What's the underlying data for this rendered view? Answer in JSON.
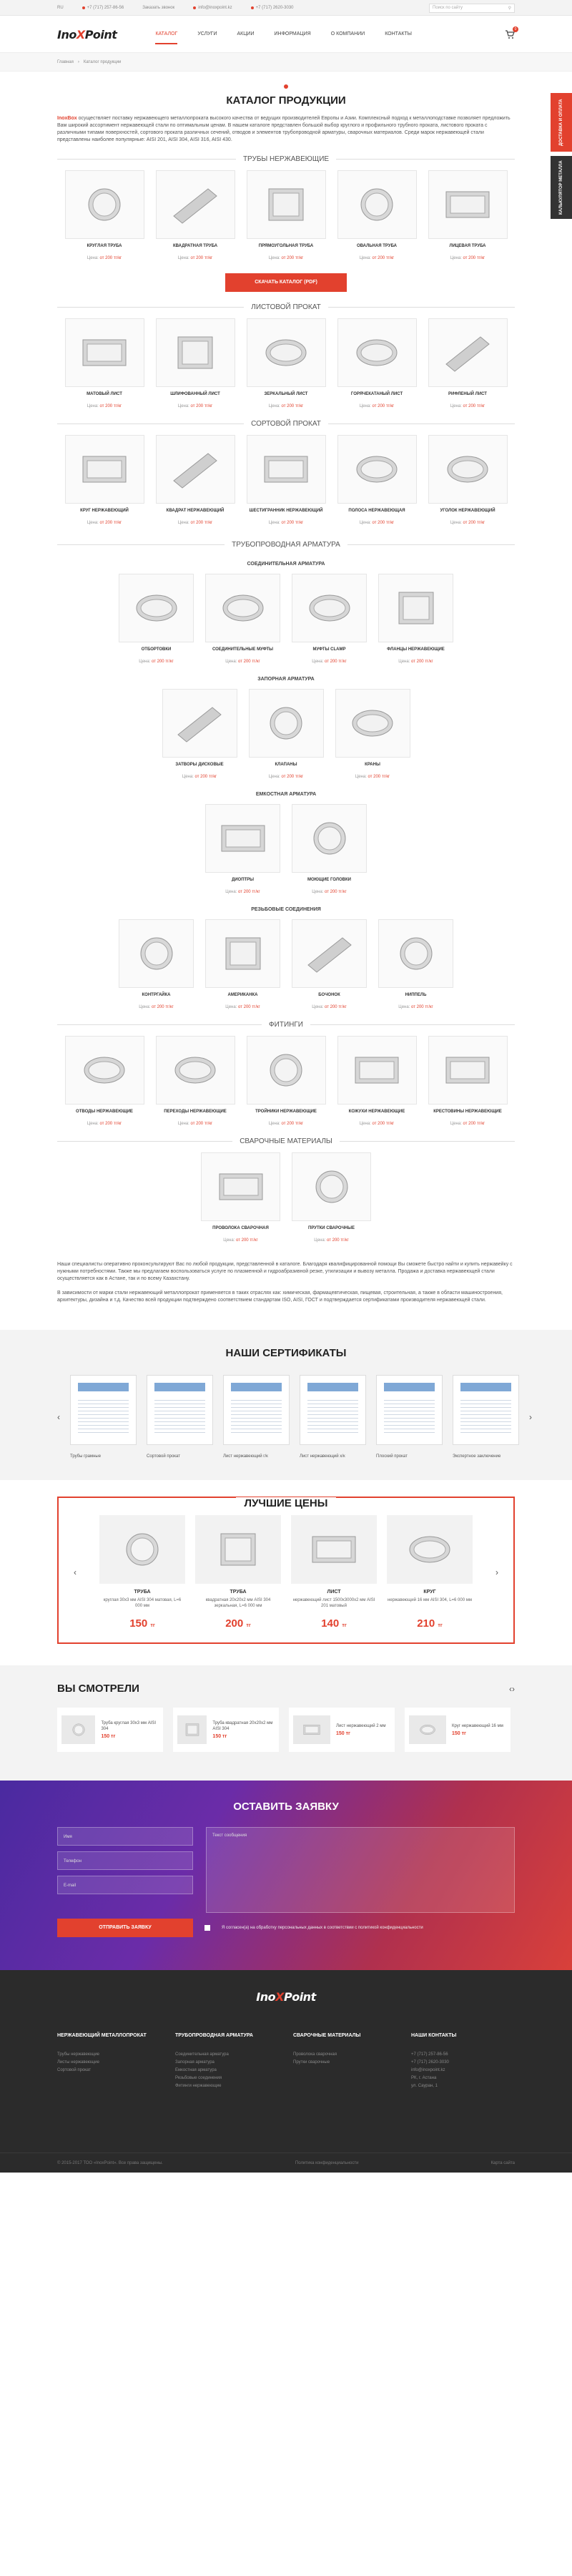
{
  "topbar": {
    "lang": "RU",
    "phone1": "+7 (717) 257-86-56",
    "callback": "Заказать звонок",
    "email": "info@inoxpoint.kz",
    "phone2": "+7 (717) 2620-3030",
    "search_placeholder": "Поиск по сайту"
  },
  "header": {
    "logo_a": "Ino",
    "logo_x": "X",
    "logo_b": "Point",
    "nav": [
      "Каталог",
      "Услуги",
      "Акции",
      "Информация",
      "О компании",
      "Контакты"
    ],
    "cart_count": "0"
  },
  "breadcrumbs": [
    "Главная",
    "Каталог продукции"
  ],
  "side_tabs": [
    "Доставка и оплата",
    "Калькулятор металла"
  ],
  "catalog": {
    "title": "КАТАЛОГ ПРОДУКЦИИ",
    "brand": "InoxBox",
    "intro": " осуществляет поставку нержавеющего металлопроката высокого качества от ведущих производителей Европы и Азии. Комплексный подход к металлоподставке позволяет предложить Вам широкий ассортимент нержавеющей стали по оптимальным ценам. В нашем каталоге представлен большой выбор круглого и профильного трубного проката, листового проката с различными типами поверхностей, сортового проката различных сечений, отводов и элементов трубопроводной арматуры, сварочных материалов. Среди марок нержавеющей стали представлены наиболее популярные: AISI 201, AISI 304, AISI 316, AISI 430.",
    "price_prefix": "Цена:",
    "price_from": "от 200 тг/кг",
    "download_btn": "Скачать каталог (PDF)"
  },
  "sections": [
    {
      "title": "Трубы нержавеющие",
      "items": [
        "Круглая труба",
        "Квадратная труба",
        "Прямоугольная труба",
        "Овальная труба",
        "Лицевая труба"
      ]
    },
    {
      "title": "Листовой прокат",
      "items": [
        "Матовый лист",
        "Шлифованный лист",
        "Зеркальный лист",
        "Горячекатаный лист",
        "Рифленый лист"
      ]
    },
    {
      "title": "Сортовой прокат",
      "items": [
        "Круг нержавеющий",
        "Квадрат нержавеющий",
        "Шестигранник нержавеющий",
        "Полоса нержавеющая",
        "Уголок нержавеющий"
      ]
    }
  ],
  "fittings_title": "Трубопроводная арматура",
  "fittings": [
    {
      "title": "Соединительная арматура",
      "items": [
        "Отбортовки",
        "Соединительные муфты",
        "Муфты clamp",
        "Фланцы нержавеющие"
      ]
    },
    {
      "title": "Запорная арматура",
      "items": [
        "Затворы дисковые",
        "Клапаны",
        "Краны"
      ]
    },
    {
      "title": "Емкостная арматура",
      "items": [
        "Диоптры",
        "Моющие головки"
      ]
    },
    {
      "title": "Резьбовые соединения",
      "items": [
        "Контргайка",
        "Американка",
        "Бочонок",
        "Ниппель"
      ]
    }
  ],
  "extra_sections": [
    {
      "title": "Фитинги",
      "items": [
        "Отводы нержавеющие",
        "Переходы нержавеющие",
        "Тройники нержавеющие",
        "Кожухи нержавеющие",
        "Крестовины нержавеющие"
      ]
    },
    {
      "title": "Сварочные материалы",
      "items": [
        "Проволока сварочная",
        "Прутки сварочные"
      ]
    }
  ],
  "bottom_text_1": "Наши специалисты оперативно проконсультируют Вас по любой продукции, представленной в каталоге. Благодаря квалифицированной помощи Вы сможете быстро найти и купить нержавейку с нужными потребностями. Также мы предлагаем воспользоваться услуге по плазменной и гидроабразивной резке, утилизации и вывозу металла. Продажа и доставка нержавеющей стали осуществляется как в Астане, так и по всему Казахстану.",
  "bottom_text_2": "В зависимости от марки стали нержавеющий металлопрокат применяется в таких отраслях как: химическая, фармацевтическая, пищевая, строительная, а также в области машиностроения, архитектуры, дизайна и т.д. Качество всей продукции подтверждено соответствием стандартам ISO, AISI, ГОСТ и подтверждается сертификатами производителя нержавеющей стали.",
  "certificates": {
    "title": "НАШИ СЕРТИФИКАТЫ",
    "items": [
      "Трубы грамные",
      "Сортовой прокат",
      "Лист нержавеющий г/к",
      "Лист нержавеющий х/к",
      "Плоский прокат",
      "Экспертное заключение"
    ]
  },
  "best_prices": {
    "title": "ЛУЧШИЕ ЦЕНЫ",
    "items": [
      {
        "t": "Труба",
        "d": "круглая 30x3 мм AISI 304 матовая, L=6 000 мм",
        "p": "150",
        "c": "тг"
      },
      {
        "t": "Труба",
        "d": "квадратная 20x20x2 мм AISI 304 зеркальная, L=6 000 мм",
        "p": "200",
        "c": "тг"
      },
      {
        "t": "Лист",
        "d": "нержавеющий лист 1500x3000x2 мм AISI 201 матовый",
        "p": "140",
        "c": "тг"
      },
      {
        "t": "Круг",
        "d": "нержавеющий 16 мм AISI 304, L=6 000 мм",
        "p": "210",
        "c": "тг"
      }
    ]
  },
  "viewed": {
    "title": "ВЫ СМОТРЕЛИ",
    "items": [
      {
        "n": "Труба круглая 30x3 мм AISI 304",
        "p": "150 тг"
      },
      {
        "n": "Труба квадратная 20x20x2 мм AISI 304",
        "p": "150 тг"
      },
      {
        "n": "Лист нержавеющий 2 мм",
        "p": "150 тг"
      },
      {
        "n": "Круг нержавеющий 16 мм",
        "p": "150 тг"
      }
    ]
  },
  "request": {
    "title": "ОСТАВИТЬ ЗАЯВКУ",
    "name": "Имя",
    "phone": "Телефон",
    "email": "E-mail",
    "comment": "Текст сообщения",
    "submit": "Отправить заявку",
    "agree": "Я согласен(а) на обработку персональных данных в соответствии с политикой конфиденциальности"
  },
  "footer": {
    "cols": [
      {
        "h": "Нержавеющий металлопрокат",
        "l": [
          "Трубы нержавеющие",
          "Листы нержавеющие",
          "Сортовой прокат"
        ]
      },
      {
        "h": "Трубопроводная арматура",
        "l": [
          "Соединительная арматура",
          "Запорная арматура",
          "Емкостная арматура",
          "Резьбовые соединения",
          "Фитинги нержавеющие"
        ]
      },
      {
        "h": "Сварочные материалы",
        "l": [
          "Проволока сварочная",
          "Прутки сварочные"
        ]
      },
      {
        "h": "Наши контакты",
        "l": [
          "+7 (717) 257-86-56",
          "+7 (717) 2620-3030",
          "info@inoxpoint.kz",
          "РК, г. Астана",
          "ул. Сауран, 1"
        ]
      }
    ],
    "copyright": "© 2015-2017 ТОО «InoxPoint». Все права защищены.",
    "policy": "Политика конфиденциальности",
    "sitemap": "Карта сайта"
  },
  "colors": {
    "accent": "#e2412e",
    "dark": "#2b2b2b"
  }
}
